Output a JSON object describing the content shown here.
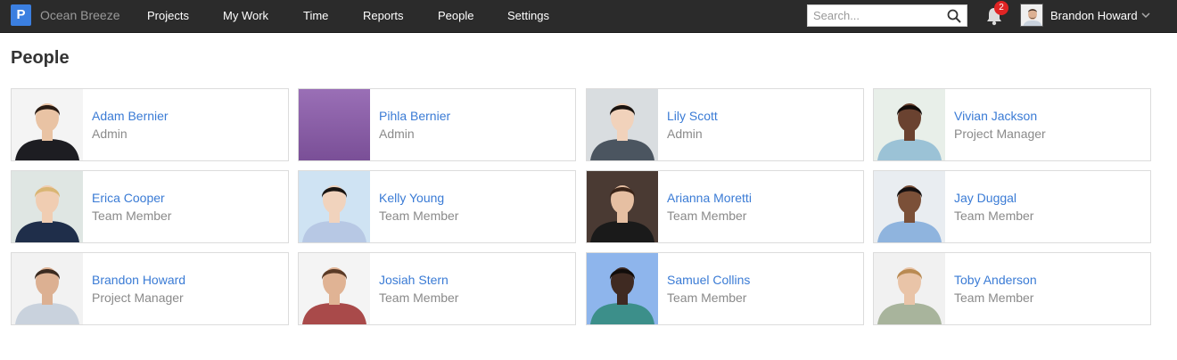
{
  "app": {
    "logo_letter": "P",
    "workspace_name": "Ocean Breeze"
  },
  "nav": [
    {
      "label": "Projects"
    },
    {
      "label": "My Work"
    },
    {
      "label": "Time"
    },
    {
      "label": "Reports"
    },
    {
      "label": "People"
    },
    {
      "label": "Settings"
    }
  ],
  "search": {
    "placeholder": "Search..."
  },
  "notifications": {
    "count": "2"
  },
  "user": {
    "name": "Brandon Howard"
  },
  "page": {
    "title": "People"
  },
  "people": [
    {
      "name": "Adam Bernier",
      "role": "Admin",
      "bg": "#f4f4f4",
      "skin": "#e9c3a4",
      "hair": "#2a1c14",
      "shirt": "#1d1d22"
    },
    {
      "name": "Pihla Bernier",
      "role": "Admin",
      "bg": "#8a5ea6",
      "skin": "",
      "hair": "",
      "shirt": ""
    },
    {
      "name": "Lily Scott",
      "role": "Admin",
      "bg": "#d9dde0",
      "skin": "#f1d2bb",
      "hair": "#1b1410",
      "shirt": "#4b5560"
    },
    {
      "name": "Vivian Jackson",
      "role": "Project Manager",
      "bg": "#e8efe9",
      "skin": "#6a4230",
      "hair": "#120c0a",
      "shirt": "#9bc2d6"
    },
    {
      "name": "Erica Cooper",
      "role": "Team Member",
      "bg": "#dfe6e3",
      "skin": "#f0cdb2",
      "hair": "#d9b573",
      "shirt": "#1f2e4a"
    },
    {
      "name": "Kelly Young",
      "role": "Team Member",
      "bg": "#cfe3f3",
      "skin": "#f1d3bd",
      "hair": "#1a1512",
      "shirt": "#b7c8e4"
    },
    {
      "name": "Arianna Moretti",
      "role": "Team Member",
      "bg": "#4a3a33",
      "skin": "#e6bfa2",
      "hair": "#3a2418",
      "shirt": "#1a1a1a"
    },
    {
      "name": "Jay Duggal",
      "role": "Team Member",
      "bg": "#e9edf1",
      "skin": "#7b5038",
      "hair": "#151010",
      "shirt": "#8fb4de"
    },
    {
      "name": "Brandon Howard",
      "role": "Project Manager",
      "bg": "#f2f2f2",
      "skin": "#dcb092",
      "hair": "#3a2a20",
      "shirt": "#c9d2dd"
    },
    {
      "name": "Josiah Stern",
      "role": "Team Member",
      "bg": "#f4f4f4",
      "skin": "#e0b394",
      "hair": "#5a3a26",
      "shirt": "#a94a4a"
    },
    {
      "name": "Samuel Collins",
      "role": "Team Member",
      "bg": "#8eb5ec",
      "skin": "#3f2a22",
      "hair": "#120d0b",
      "shirt": "#3c8f8a"
    },
    {
      "name": "Toby Anderson",
      "role": "Team Member",
      "bg": "#f1f1f1",
      "skin": "#e9c4a8",
      "hair": "#b98a52",
      "shirt": "#a8b49c"
    }
  ]
}
